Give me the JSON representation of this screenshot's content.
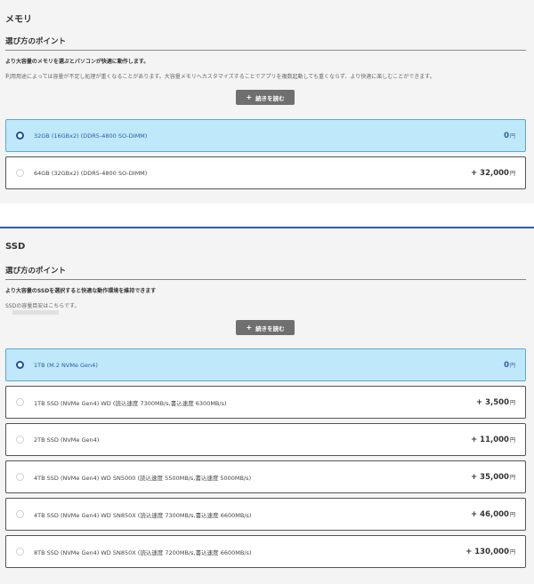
{
  "memory": {
    "title": "メモリ",
    "point_heading": "選び方のポイント",
    "lead": "より大容量のメモリを選ぶとパソコンが快適に動作します。",
    "description": "利用用途によっては容量が不足し処理が重くなることがあります。大容量メモリへカスタマイズすることでアプリを複数起動しても重くならず、より快適に楽しむことができます。",
    "more_plus": "+",
    "more_label": "続きを読む",
    "options": [
      {
        "label": "32GB (16GBx2) (DDR5-4800 SO-DIMM)",
        "price": "0",
        "unit": "円",
        "selected": true
      },
      {
        "label": "64GB (32GBx2) (DDR5-4800 SO-DIMM)",
        "price": "+ 32,000",
        "unit": "円",
        "selected": false
      }
    ]
  },
  "ssd": {
    "title": "SSD",
    "point_heading": "選び方のポイント",
    "lead": "より大容量のSSDを選択すると快適な動作環境を維持できます",
    "description": "SSDの容量目安はこちらです。",
    "more_plus": "+",
    "more_label": "続きを読む",
    "options": [
      {
        "label": "1TB (M.2 NVMe Gen4)",
        "price": "0",
        "unit": "円",
        "selected": true
      },
      {
        "label": "1TB SSD (NVMe Gen4) WD (読込速度 7300MB/s,書込速度 6300MB/s)",
        "price": "+ 3,500",
        "unit": "円",
        "selected": false
      },
      {
        "label": "2TB SSD (NVMe Gen4)",
        "price": "+ 11,000",
        "unit": "円",
        "selected": false
      },
      {
        "label": "4TB SSD (NVMe Gen4) WD SN5000 (読込速度 5500MB/s,書込速度 5000MB/s)",
        "price": "+ 35,000",
        "unit": "円",
        "selected": false
      },
      {
        "label": "4TB SSD (NVMe Gen4) WD SN850X (読込速度 7300MB/s,書込速度 6600MB/s)",
        "price": "+ 46,000",
        "unit": "円",
        "selected": false
      },
      {
        "label": "8TB SSD (NVMe Gen4) WD SN850X (読込速度 7200MB/s,書込速度 6600MB/s)",
        "price": "+ 130,000",
        "unit": "円",
        "selected": false
      }
    ]
  },
  "colors": {
    "selected_bg": "#bfe8fa",
    "selected_text": "#2a5fa8",
    "radio_selected": "#1f4f9a",
    "button_bg": "#6f6f6f",
    "section_divider": "#2f5aa8"
  }
}
